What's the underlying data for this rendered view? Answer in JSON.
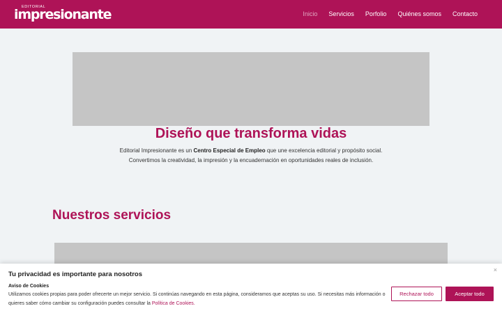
{
  "header": {
    "logo_small": "EDITORIAL",
    "logo_big": "impresionante",
    "nav": [
      "Inicio",
      "Servicios",
      "Porfolio",
      "Quiénes somos",
      "Contacto"
    ]
  },
  "hero": {
    "title": "Diseño que transforma vidas",
    "text_before": "Editorial Impresionante es un ",
    "text_bold": "Centro Especial de Empleo",
    "text_after": " que une excelencia editorial y propósito social.",
    "text_line2": "Convertimos la creatividad, la impresión y la encuadernación en oportunidades reales de inclusión."
  },
  "services": {
    "title": "Nuestros servicios"
  },
  "cookie": {
    "title": "Tu privacidad es importante para nosotros",
    "subtitle": "Aviso de Cookies",
    "body": "Utilizamos cookies propias para poder ofrecerte un mejor servicio. Si continúas navegando en esta página, consideramos que aceptas su uso. Si necesitas más información o quieres saber cómo cambiar su configuración puedes consultar la ",
    "link": "Política de Cookies.",
    "close": "×",
    "reject_label": "Rechazar todo",
    "accept_label": "Aceptar todo"
  },
  "colors": {
    "brand": "#ae1357",
    "background": "#f0f3f5",
    "placeholder": "#c5c5c5"
  }
}
